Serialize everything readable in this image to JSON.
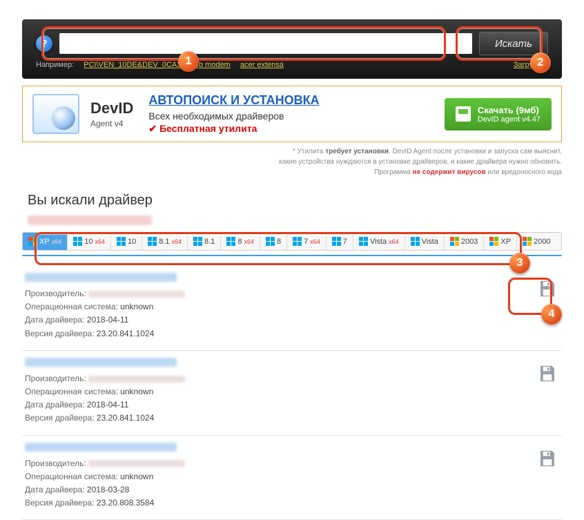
{
  "topbar": {
    "search_value": "",
    "search_btn": "Искать",
    "example_label": "Например:",
    "examples": [
      "PCI\\VEN_10DE&DEV_0CA3",
      "usb modem",
      "acer extensa"
    ],
    "load_link": "Загрузить"
  },
  "promo": {
    "title": "DevID",
    "subtitle": "Agent v4",
    "auto_link": "АВТОПОИСК И УСТАНОВКА",
    "desc": "Всех необходимых драйверов",
    "free": "Бесплатная утилита",
    "dl_l1": "Скачать (9мб)",
    "dl_l2": "DevID agent v4.47"
  },
  "note": {
    "l1a": "* Утилита ",
    "l1b": "требует установки",
    "l1c": ". DevID Agent после установки и запуска сам выяснит,",
    "l2": "какие устройства нуждаются в установке драйверов, и какие драйвера нужно обновить.",
    "l3a": "Программа ",
    "l3b": "не содержит вирусов",
    "l3c": " или вредоносного кода"
  },
  "section_title": "Вы искали драйвер",
  "os_tabs": [
    {
      "label": "XP",
      "x64": true,
      "active": true,
      "xp": true
    },
    {
      "label": "10",
      "x64": true
    },
    {
      "label": "10"
    },
    {
      "label": "8.1",
      "x64": true
    },
    {
      "label": "8.1"
    },
    {
      "label": "8",
      "x64": true
    },
    {
      "label": "8"
    },
    {
      "label": "7",
      "x64": true
    },
    {
      "label": "7"
    },
    {
      "label": "Vista",
      "x64": true
    },
    {
      "label": "Vista"
    },
    {
      "label": "2003",
      "xp": true
    },
    {
      "label": "XP",
      "xp": true
    },
    {
      "label": "2000",
      "xp": true
    }
  ],
  "labels": {
    "manufacturer": "Производитель:",
    "os": "Операционная система:",
    "date": "Дата драйвера:",
    "version": "Версия драйвера:"
  },
  "results": [
    {
      "os": "unknown",
      "date": "2018-04-11",
      "version": "23.20.841.1024"
    },
    {
      "os": "unknown",
      "date": "2018-04-11",
      "version": "23.20.841.1024"
    },
    {
      "os": "unknown",
      "date": "2018-03-28",
      "version": "23.20.808.3584"
    }
  ],
  "callouts": {
    "1": "1",
    "2": "2",
    "3": "3",
    "4": "4"
  }
}
